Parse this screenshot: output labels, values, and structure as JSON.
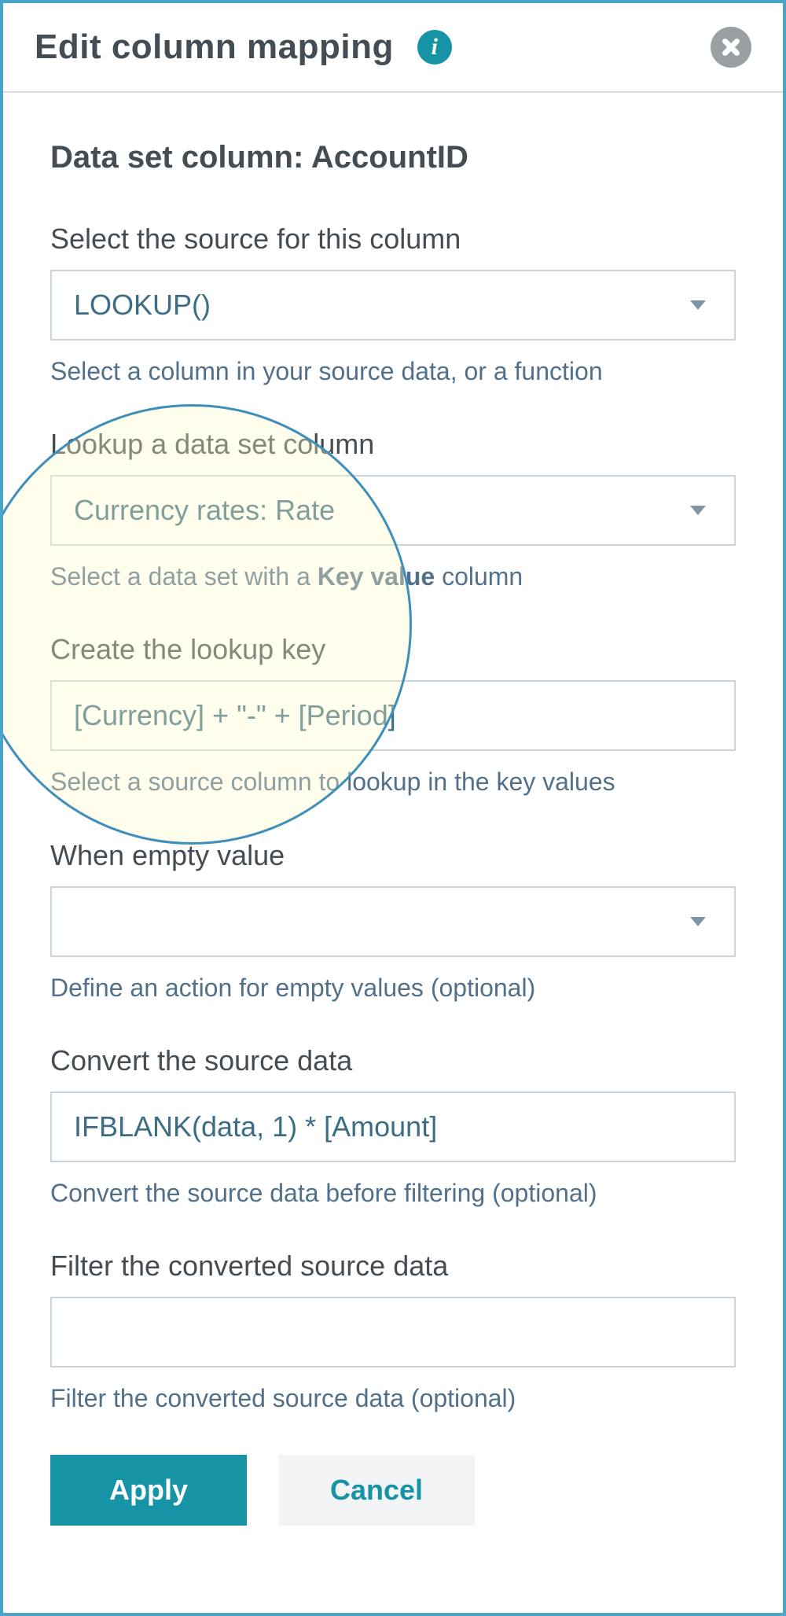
{
  "header": {
    "title": "Edit column mapping"
  },
  "sectionTitle": "Data set column: AccountID",
  "fields": {
    "source": {
      "label": "Select the source for this column",
      "value": "LOOKUP()",
      "helper": "Select a column in your source data, or a function"
    },
    "lookupColumn": {
      "label": "Lookup a data set column",
      "value": "Currency rates: Rate",
      "helperPrefix": "Select a data set with a ",
      "helperBold": "Key value",
      "helperSuffix": " column"
    },
    "lookupKey": {
      "label": "Create the lookup key",
      "value": "[Currency] + \"-\" + [Period]",
      "helper": "Select a source column to lookup in the key values"
    },
    "emptyValue": {
      "label": "When empty value",
      "value": "",
      "helper": "Define an action for empty values (optional)"
    },
    "convert": {
      "label": "Convert the source data",
      "value": "IFBLANK(data, 1) * [Amount]",
      "helper": "Convert the source data before filtering (optional)"
    },
    "filter": {
      "label": "Filter the converted source data",
      "value": "",
      "helper": "Filter the converted source data (optional)"
    }
  },
  "buttons": {
    "apply": "Apply",
    "cancel": "Cancel"
  }
}
